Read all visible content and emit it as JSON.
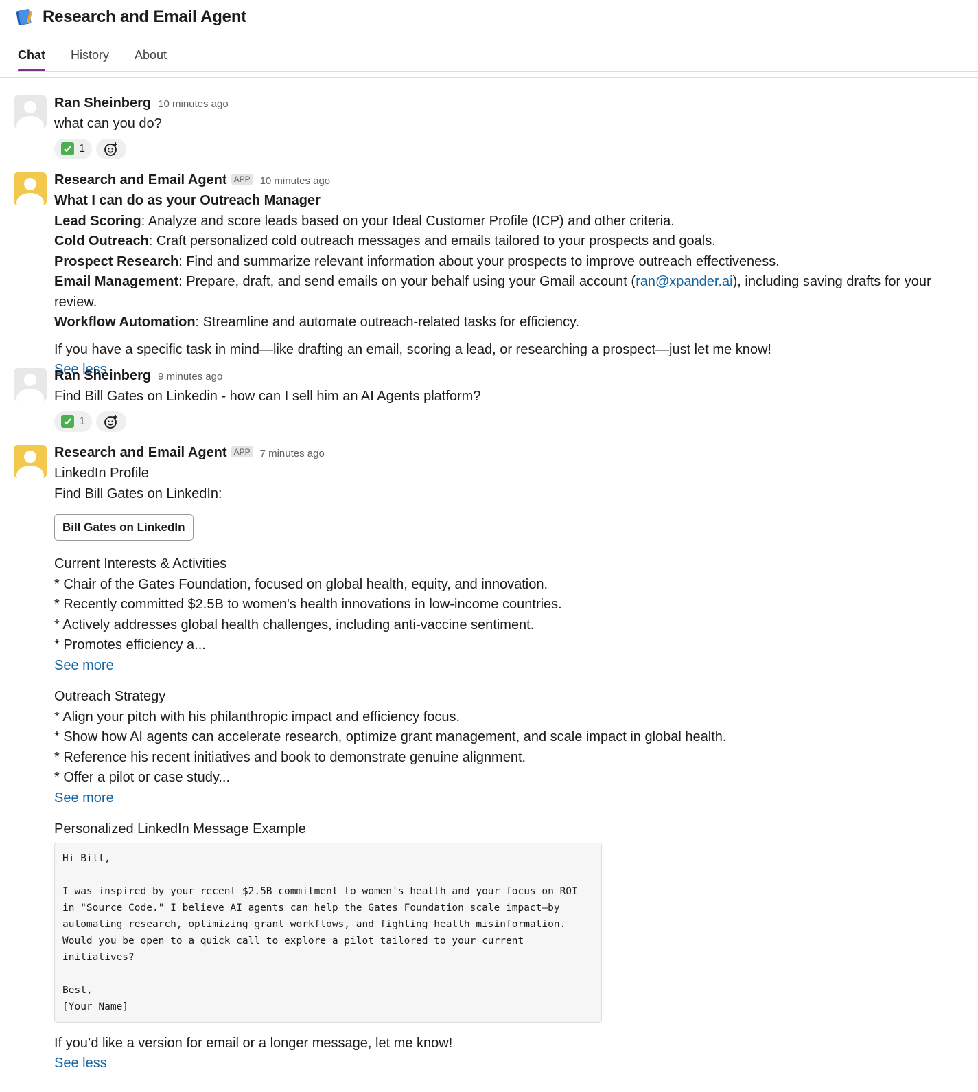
{
  "header": {
    "title": "Research and Email Agent",
    "app_icon": "notebook-icon",
    "tabs": [
      {
        "label": "Chat",
        "active": true
      },
      {
        "label": "History",
        "active": false
      },
      {
        "label": "About",
        "active": false
      }
    ]
  },
  "colors": {
    "tab_active_underline": "#7c3085",
    "link": "#1264a3",
    "bot_avatar": "#f2c94c",
    "user_avatar": "#e8e8e8"
  },
  "messages": [
    {
      "sender": "Ran Sheinberg",
      "time": "10 minutes ago",
      "text": "what can you do?",
      "reaction_count": "1"
    },
    {
      "sender": "Research and Email Agent",
      "badge": "APP",
      "time": "10 minutes ago",
      "heading": "What I can do as your Outreach Manager",
      "items": [
        {
          "term": "Lead Scoring",
          "desc": ": Analyze and score leads based on your Ideal Customer Profile (ICP) and other criteria."
        },
        {
          "term": "Cold Outreach",
          "desc": ": Craft personalized cold outreach messages and emails tailored to your prospects and goals."
        },
        {
          "term": "Prospect Research",
          "desc": ": Find and summarize relevant information about your prospects to improve outreach effectiveness."
        },
        {
          "term": "Email Management",
          "desc_before": ": Prepare, draft, and send emails on your behalf using your Gmail account (",
          "email": "ran@xpander.ai",
          "desc_after": "), including saving drafts for your review."
        },
        {
          "term": "Workflow Automation",
          "desc": ": Streamline and automate outreach-related tasks for efficiency."
        }
      ],
      "closing": "If you have a specific task in mind—like drafting an email, scoring a lead, or researching a prospect—just let me know!",
      "see_less": "See less"
    },
    {
      "sender": "Ran Sheinberg",
      "time": "9 minutes ago",
      "text": "Find Bill Gates on Linkedin - how can I sell him an AI Agents platform?",
      "reaction_count": "1"
    },
    {
      "sender": "Research and Email Agent",
      "badge": "APP",
      "time": "7 minutes ago",
      "profile_heading": "LinkedIn Profile",
      "profile_text": "Find Bill Gates on LinkedIn:",
      "profile_button": "Bill Gates on LinkedIn",
      "interests_heading": "Current Interests & Activities",
      "interests": [
        "* Chair of the Gates Foundation, focused on global health, equity, and innovation.",
        "* Recently committed $2.5B to women's health innovations in low-income countries.",
        "* Actively addresses global health challenges, including anti-vaccine sentiment.",
        "* Promotes efficiency a..."
      ],
      "interests_see_more": "See more",
      "strategy_heading": "Outreach Strategy",
      "strategy": [
        "* Align your pitch with his philanthropic impact and efficiency focus.",
        "* Show how AI agents can accelerate research, optimize grant management, and scale impact in global health.",
        "* Reference his recent initiatives and book to demonstrate genuine alignment.",
        "* Offer a pilot or case study..."
      ],
      "strategy_see_more": "See more",
      "example_heading": "Personalized LinkedIn Message Example",
      "code": "Hi Bill,\n\nI was inspired by your recent $2.5B commitment to women's health and your focus on ROI\nin \"Source Code.\" I believe AI agents can help the Gates Foundation scale impact—by\nautomating research, optimizing grant workflows, and fighting health misinformation.\nWould you be open to a quick call to explore a pilot tailored to your current\ninitiatives?\n\nBest,\n[Your Name]",
      "closing": "If you’d like a version for email or a longer message, let me know!",
      "see_less": "See less"
    }
  ]
}
